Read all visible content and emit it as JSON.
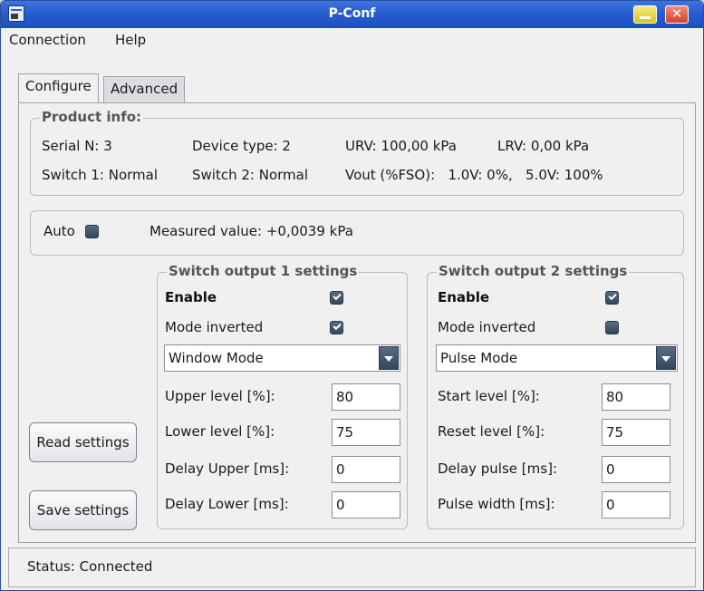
{
  "window": {
    "title": "P-Conf"
  },
  "menu": {
    "connection": "Connection",
    "help": "Help"
  },
  "tabs": {
    "configure": "Configure",
    "advanced": "Advanced"
  },
  "product_info": {
    "title": "Product info:",
    "serial": "Serial N: 3",
    "device_type": "Device type: 2",
    "urv": "URV: 100,00 kPa",
    "lrv": "LRV: 0,00 kPa",
    "switch1": "Switch 1: Normal",
    "switch2": "Switch 2: Normal",
    "vout": "Vout (%FSO):   1.0V: 0%,   5.0V: 100%"
  },
  "measure": {
    "auto_label": "Auto",
    "measured_value": "Measured value: +0,0039 kPa"
  },
  "switch1": {
    "title": "Switch output 1 settings",
    "enable_label": "Enable",
    "mode_inverted_label": "Mode inverted",
    "mode": "Window Mode",
    "upper_label": "Upper level [%]:",
    "upper_value": "80",
    "lower_label": "Lower level [%]:",
    "lower_value": "75",
    "delay_upper_label": "Delay Upper [ms]:",
    "delay_upper_value": "0",
    "delay_lower_label": "Delay Lower [ms]:",
    "delay_lower_value": "0"
  },
  "switch2": {
    "title": "Switch output 2 settings",
    "enable_label": "Enable",
    "mode_inverted_label": "Mode inverted",
    "mode": "Pulse Mode",
    "start_label": "Start level [%]:",
    "start_value": "80",
    "reset_label": "Reset level [%]:",
    "reset_value": "75",
    "delay_pulse_label": "Delay pulse [ms]:",
    "delay_pulse_value": "0",
    "pulse_width_label": "Pulse width [ms]:",
    "pulse_width_value": "0"
  },
  "buttons": {
    "read": "Read settings",
    "save": "Save settings"
  },
  "status": {
    "text": "Status: Connected"
  },
  "icons": {
    "app": "app-icon",
    "minimize": "minimize-icon",
    "close": "close-icon",
    "dropdown": "chevron-down-icon"
  }
}
